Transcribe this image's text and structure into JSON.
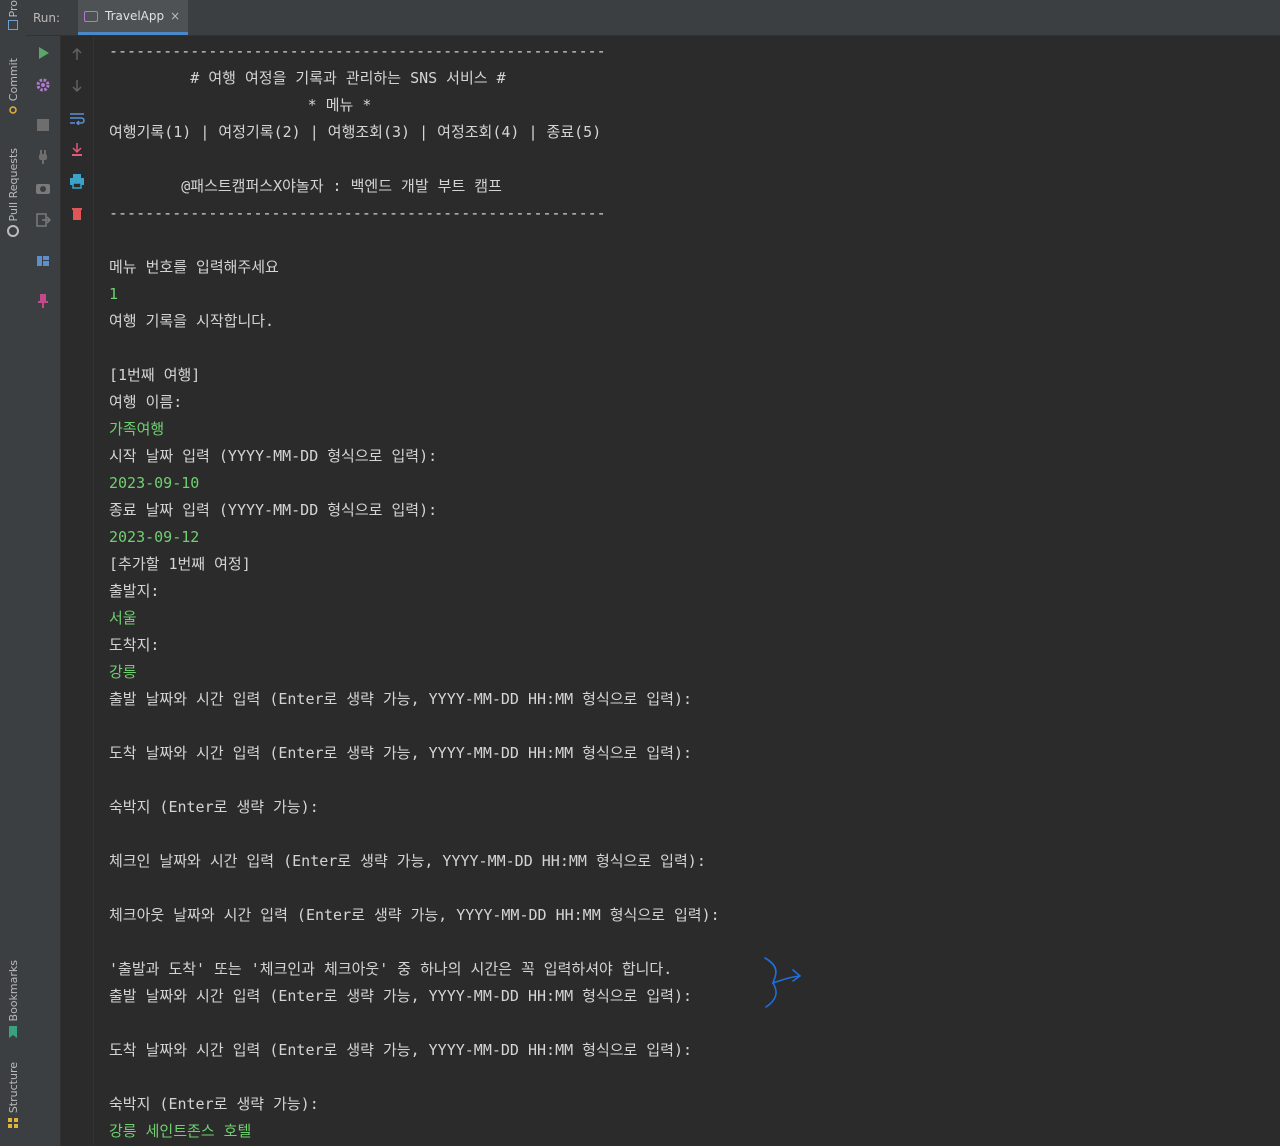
{
  "left_stripe": {
    "project_label": "Pro",
    "commit_label": "Commit",
    "pull_requests_label": "Pull Requests",
    "bookmarks_label": "Bookmarks",
    "structure_label": "Structure"
  },
  "run_panel": {
    "label": "Run:",
    "tab": {
      "label": "TravelApp",
      "close_glyph": "×"
    }
  },
  "toolbar": {
    "buttons": [
      "rerun-icon",
      "settings-icon",
      "stop-icon",
      "plug-icon",
      "camera-icon",
      "exit-icon",
      "layout-icon",
      "pin-icon"
    ],
    "secondary": [
      "arrow-up-icon",
      "arrow-down-icon",
      "soft-wrap-icon",
      "scroll-to-end-icon",
      "print-icon",
      "trash-icon"
    ]
  },
  "colors": {
    "background": "#2b2b2b",
    "panel": "#3c3f41",
    "output_text": "#d4d4d4",
    "user_input": "#6fd06f",
    "run_green": "#59a869",
    "trash_red": "#e05555",
    "annotation_blue": "#1f6fe0"
  },
  "console": {
    "lines": [
      {
        "text": "-------------------------------------------------------",
        "input": false
      },
      {
        "text": "         # 여행 여정을 기록과 관리하는 SNS 서비스 #",
        "input": false
      },
      {
        "text": "                      * 메뉴 *",
        "input": false
      },
      {
        "text": "여행기록(1) | 여정기록(2) | 여행조회(3) | 여정조회(4) | 종료(5)",
        "input": false
      },
      {
        "text": "",
        "input": false
      },
      {
        "text": "        @패스트캠퍼스X야놀자 : 백엔드 개발 부트 캠프",
        "input": false
      },
      {
        "text": "-------------------------------------------------------",
        "input": false
      },
      {
        "text": "",
        "input": false
      },
      {
        "text": "메뉴 번호를 입력해주세요",
        "input": false
      },
      {
        "text": "1",
        "input": true
      },
      {
        "text": "여행 기록을 시작합니다.",
        "input": false
      },
      {
        "text": "",
        "input": false
      },
      {
        "text": "[1번째 여행]",
        "input": false
      },
      {
        "text": "여행 이름:",
        "input": false
      },
      {
        "text": "가족여행",
        "input": true
      },
      {
        "text": "시작 날짜 입력 (YYYY-MM-DD 형식으로 입력):",
        "input": false
      },
      {
        "text": "2023-09-10",
        "input": true
      },
      {
        "text": "종료 날짜 입력 (YYYY-MM-DD 형식으로 입력):",
        "input": false
      },
      {
        "text": "2023-09-12",
        "input": true
      },
      {
        "text": "[추가할 1번째 여정]",
        "input": false
      },
      {
        "text": "출발지:",
        "input": false
      },
      {
        "text": "서울",
        "input": true
      },
      {
        "text": "도착지:",
        "input": false
      },
      {
        "text": "강릉",
        "input": true
      },
      {
        "text": "출발 날짜와 시간 입력 (Enter로 생략 가능, YYYY-MM-DD HH:MM 형식으로 입력):",
        "input": false
      },
      {
        "text": "",
        "input": false
      },
      {
        "text": "도착 날짜와 시간 입력 (Enter로 생략 가능, YYYY-MM-DD HH:MM 형식으로 입력):",
        "input": false
      },
      {
        "text": "",
        "input": false
      },
      {
        "text": "숙박지 (Enter로 생략 가능):",
        "input": false
      },
      {
        "text": "",
        "input": false
      },
      {
        "text": "체크인 날짜와 시간 입력 (Enter로 생략 가능, YYYY-MM-DD HH:MM 형식으로 입력):",
        "input": false
      },
      {
        "text": "",
        "input": false
      },
      {
        "text": "체크아웃 날짜와 시간 입력 (Enter로 생략 가능, YYYY-MM-DD HH:MM 형식으로 입력):",
        "input": false
      },
      {
        "text": "",
        "input": false
      },
      {
        "text": "'출발과 도착' 또는 '체크인과 체크아웃' 중 하나의 시간은 꼭 입력하셔야 합니다.",
        "input": false
      },
      {
        "text": "출발 날짜와 시간 입력 (Enter로 생략 가능, YYYY-MM-DD HH:MM 형식으로 입력):",
        "input": false
      },
      {
        "text": "",
        "input": false
      },
      {
        "text": "도착 날짜와 시간 입력 (Enter로 생략 가능, YYYY-MM-DD HH:MM 형식으로 입력):",
        "input": false
      },
      {
        "text": "",
        "input": false
      },
      {
        "text": "숙박지 (Enter로 생략 가능):",
        "input": false
      },
      {
        "text": "강릉 세인트존스 호텔",
        "input": true
      }
    ]
  }
}
